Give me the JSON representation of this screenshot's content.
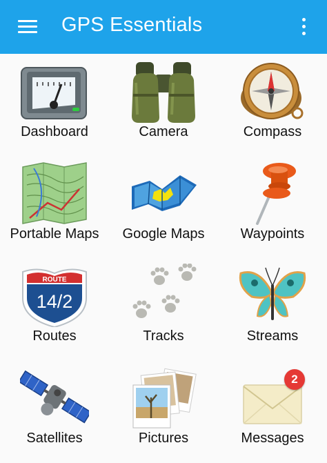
{
  "app_bar": {
    "title": "GPS Essentials",
    "menu_icon": "hamburger-menu-icon",
    "overflow_icon": "overflow-menu-icon",
    "color": "#1ea3ea"
  },
  "tiles": [
    {
      "label": "Dashboard",
      "icon": "dashboard-gauge-icon"
    },
    {
      "label": "Camera",
      "icon": "binoculars-icon"
    },
    {
      "label": "Compass",
      "icon": "compass-icon"
    },
    {
      "label": "Portable Maps",
      "icon": "topographic-map-icon"
    },
    {
      "label": "Google Maps",
      "icon": "folded-map-icon"
    },
    {
      "label": "Waypoints",
      "icon": "push-pin-icon"
    },
    {
      "label": "Routes",
      "icon": "route-shield-icon",
      "shield_top": "ROUTE",
      "shield_number": "14/2"
    },
    {
      "label": "Tracks",
      "icon": "paw-prints-icon"
    },
    {
      "label": "Streams",
      "icon": "butterfly-icon"
    },
    {
      "label": "Satellites",
      "icon": "satellite-icon"
    },
    {
      "label": "Pictures",
      "icon": "photo-stack-icon"
    },
    {
      "label": "Messages",
      "icon": "envelope-icon",
      "badge_count": "2",
      "badge_color": "#e53935"
    }
  ]
}
